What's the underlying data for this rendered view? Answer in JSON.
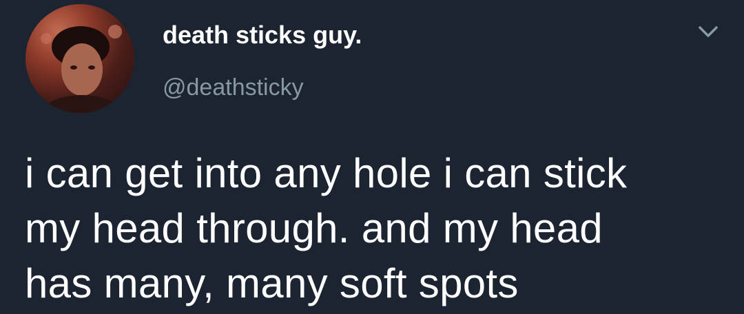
{
  "author": {
    "display_name": "death sticks guy.",
    "handle": "@deathsticky"
  },
  "icons": {
    "menu": "chevron-down-icon"
  },
  "tweet": {
    "lines": [
      "i can get into any hole i can stick",
      "my head through. and my head",
      "has many, many soft spots"
    ]
  },
  "colors": {
    "background": "#1b2430",
    "text": "#ffffff",
    "secondary_text": "#8899a6"
  }
}
